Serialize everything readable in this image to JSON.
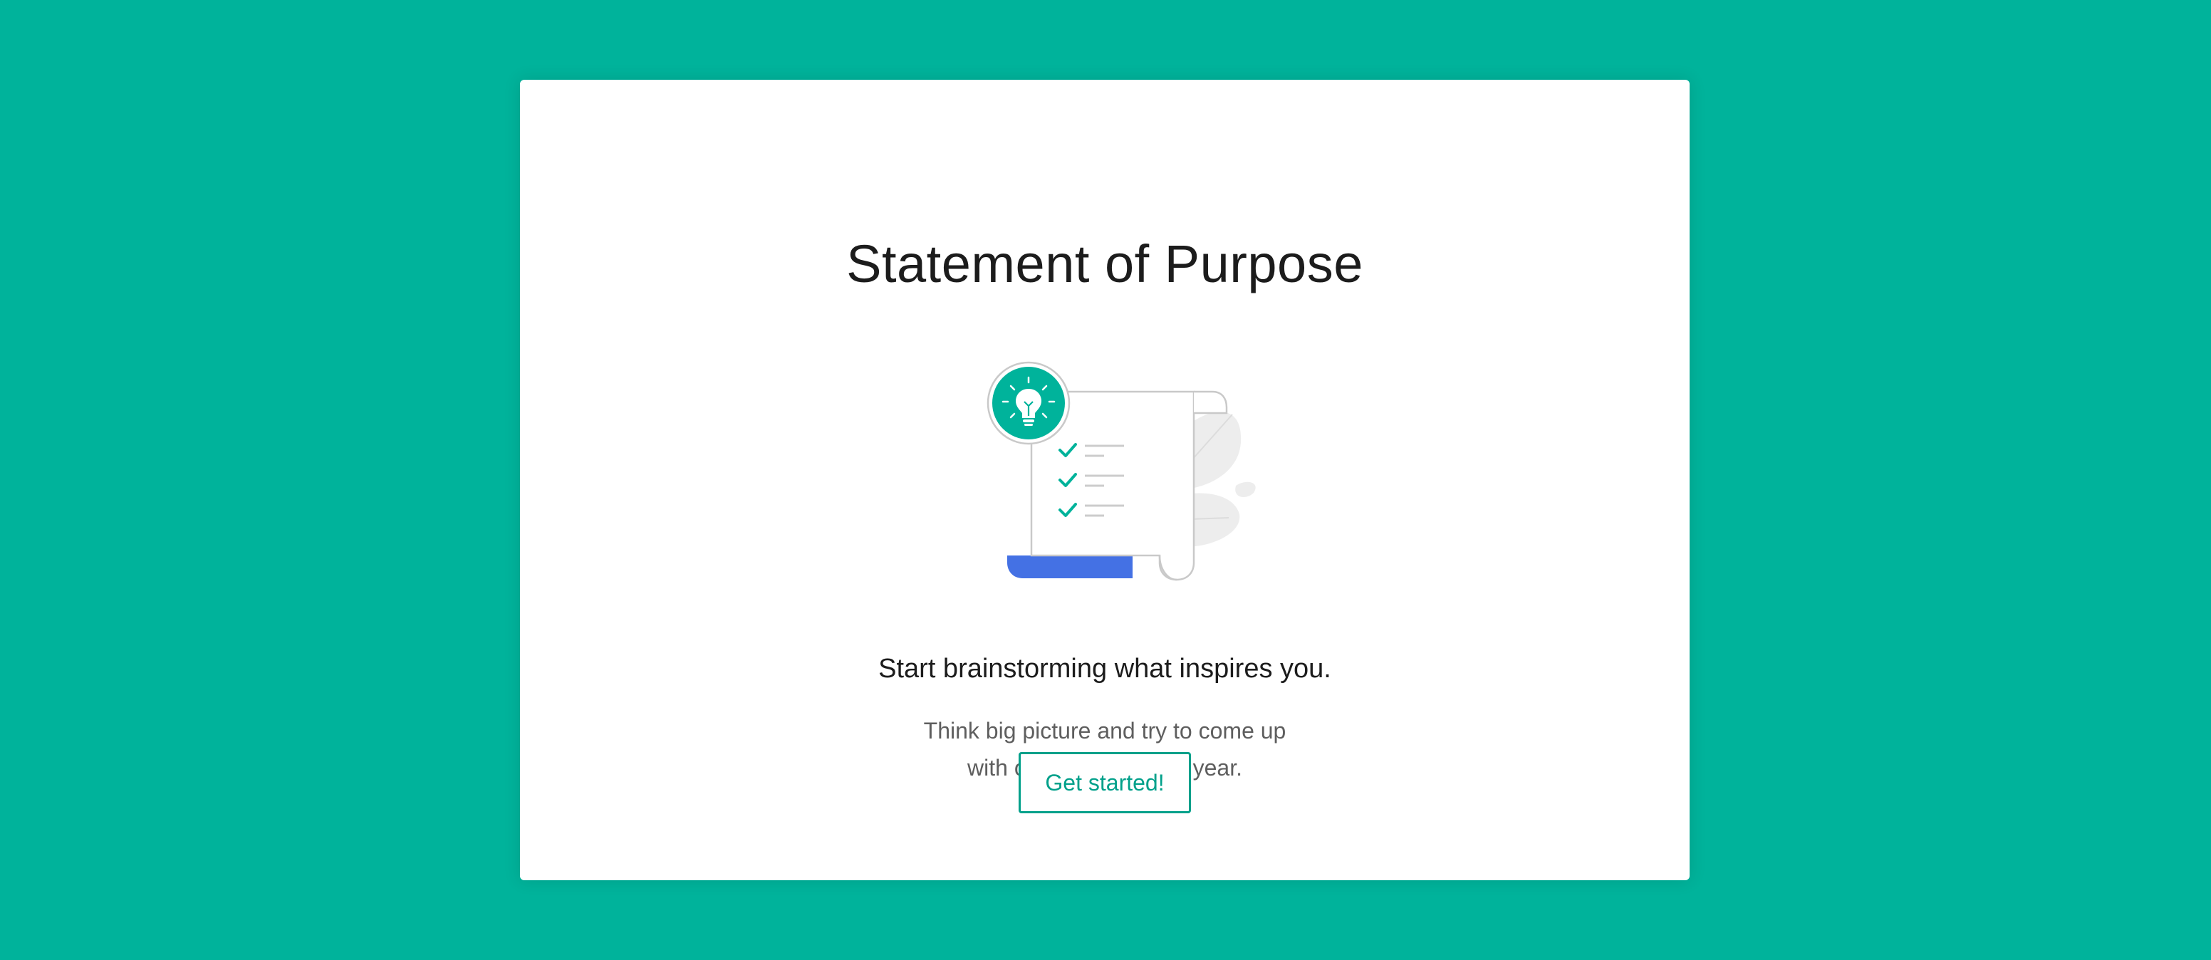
{
  "colors": {
    "background": "#00b39b",
    "card": "#ffffff",
    "accent": "#00a08a",
    "illustration_base": "#4471e4"
  },
  "card": {
    "title": "Statement of Purpose",
    "illustration": {
      "icons": [
        "lightbulb-icon",
        "checkmark-icon",
        "checkmark-icon",
        "checkmark-icon",
        "leaf-icon"
      ]
    },
    "subtitle": "Start brainstorming what inspires you.",
    "description_lines": [
      "Think big picture and try to come up",
      "with objectives for the year."
    ],
    "cta_label": "Get started!"
  }
}
